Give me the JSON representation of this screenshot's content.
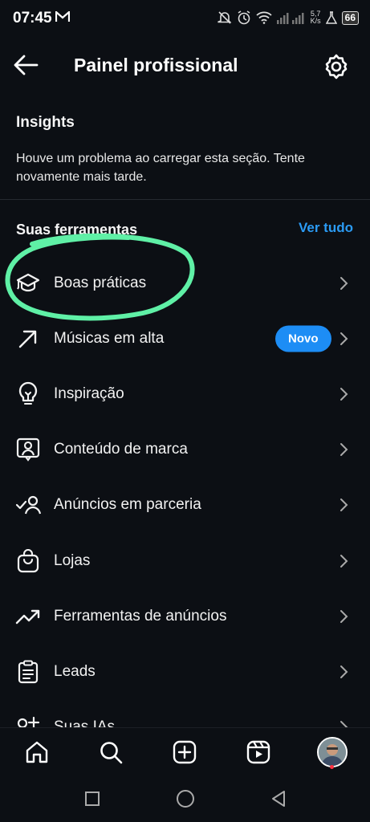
{
  "status": {
    "time": "07:45",
    "speed_value": "5,7",
    "speed_unit": "K/s",
    "battery": "66"
  },
  "header": {
    "title": "Painel profissional"
  },
  "insights": {
    "title": "Insights",
    "message": "Houve um problema ao carregar esta seção. Tente novamente mais tarde."
  },
  "tools": {
    "title": "Suas ferramentas",
    "see_all": "Ver tudo",
    "items": [
      {
        "label": "Boas práticas",
        "icon": "graduation-cap-icon"
      },
      {
        "label": "Músicas em alta",
        "icon": "trending-arrow-icon",
        "badge": "Novo"
      },
      {
        "label": "Inspiração",
        "icon": "lightbulb-icon"
      },
      {
        "label": "Conteúdo de marca",
        "icon": "branded-content-icon"
      },
      {
        "label": "Anúncios em parceria",
        "icon": "partnership-ads-icon"
      },
      {
        "label": "Lojas",
        "icon": "shopping-bag-icon"
      },
      {
        "label": "Ferramentas de anúncios",
        "icon": "trending-up-icon"
      },
      {
        "label": "Leads",
        "icon": "clipboard-icon"
      },
      {
        "label": "Suas IAs",
        "icon": "ai-sparkle-icon"
      }
    ]
  },
  "tabbar": {
    "items": [
      "home-icon",
      "search-icon",
      "create-icon",
      "reels-icon",
      "profile-avatar"
    ]
  },
  "colors": {
    "background": "#0c0f14",
    "accent": "#1d8df5",
    "annotation": "#5ff0a6"
  }
}
